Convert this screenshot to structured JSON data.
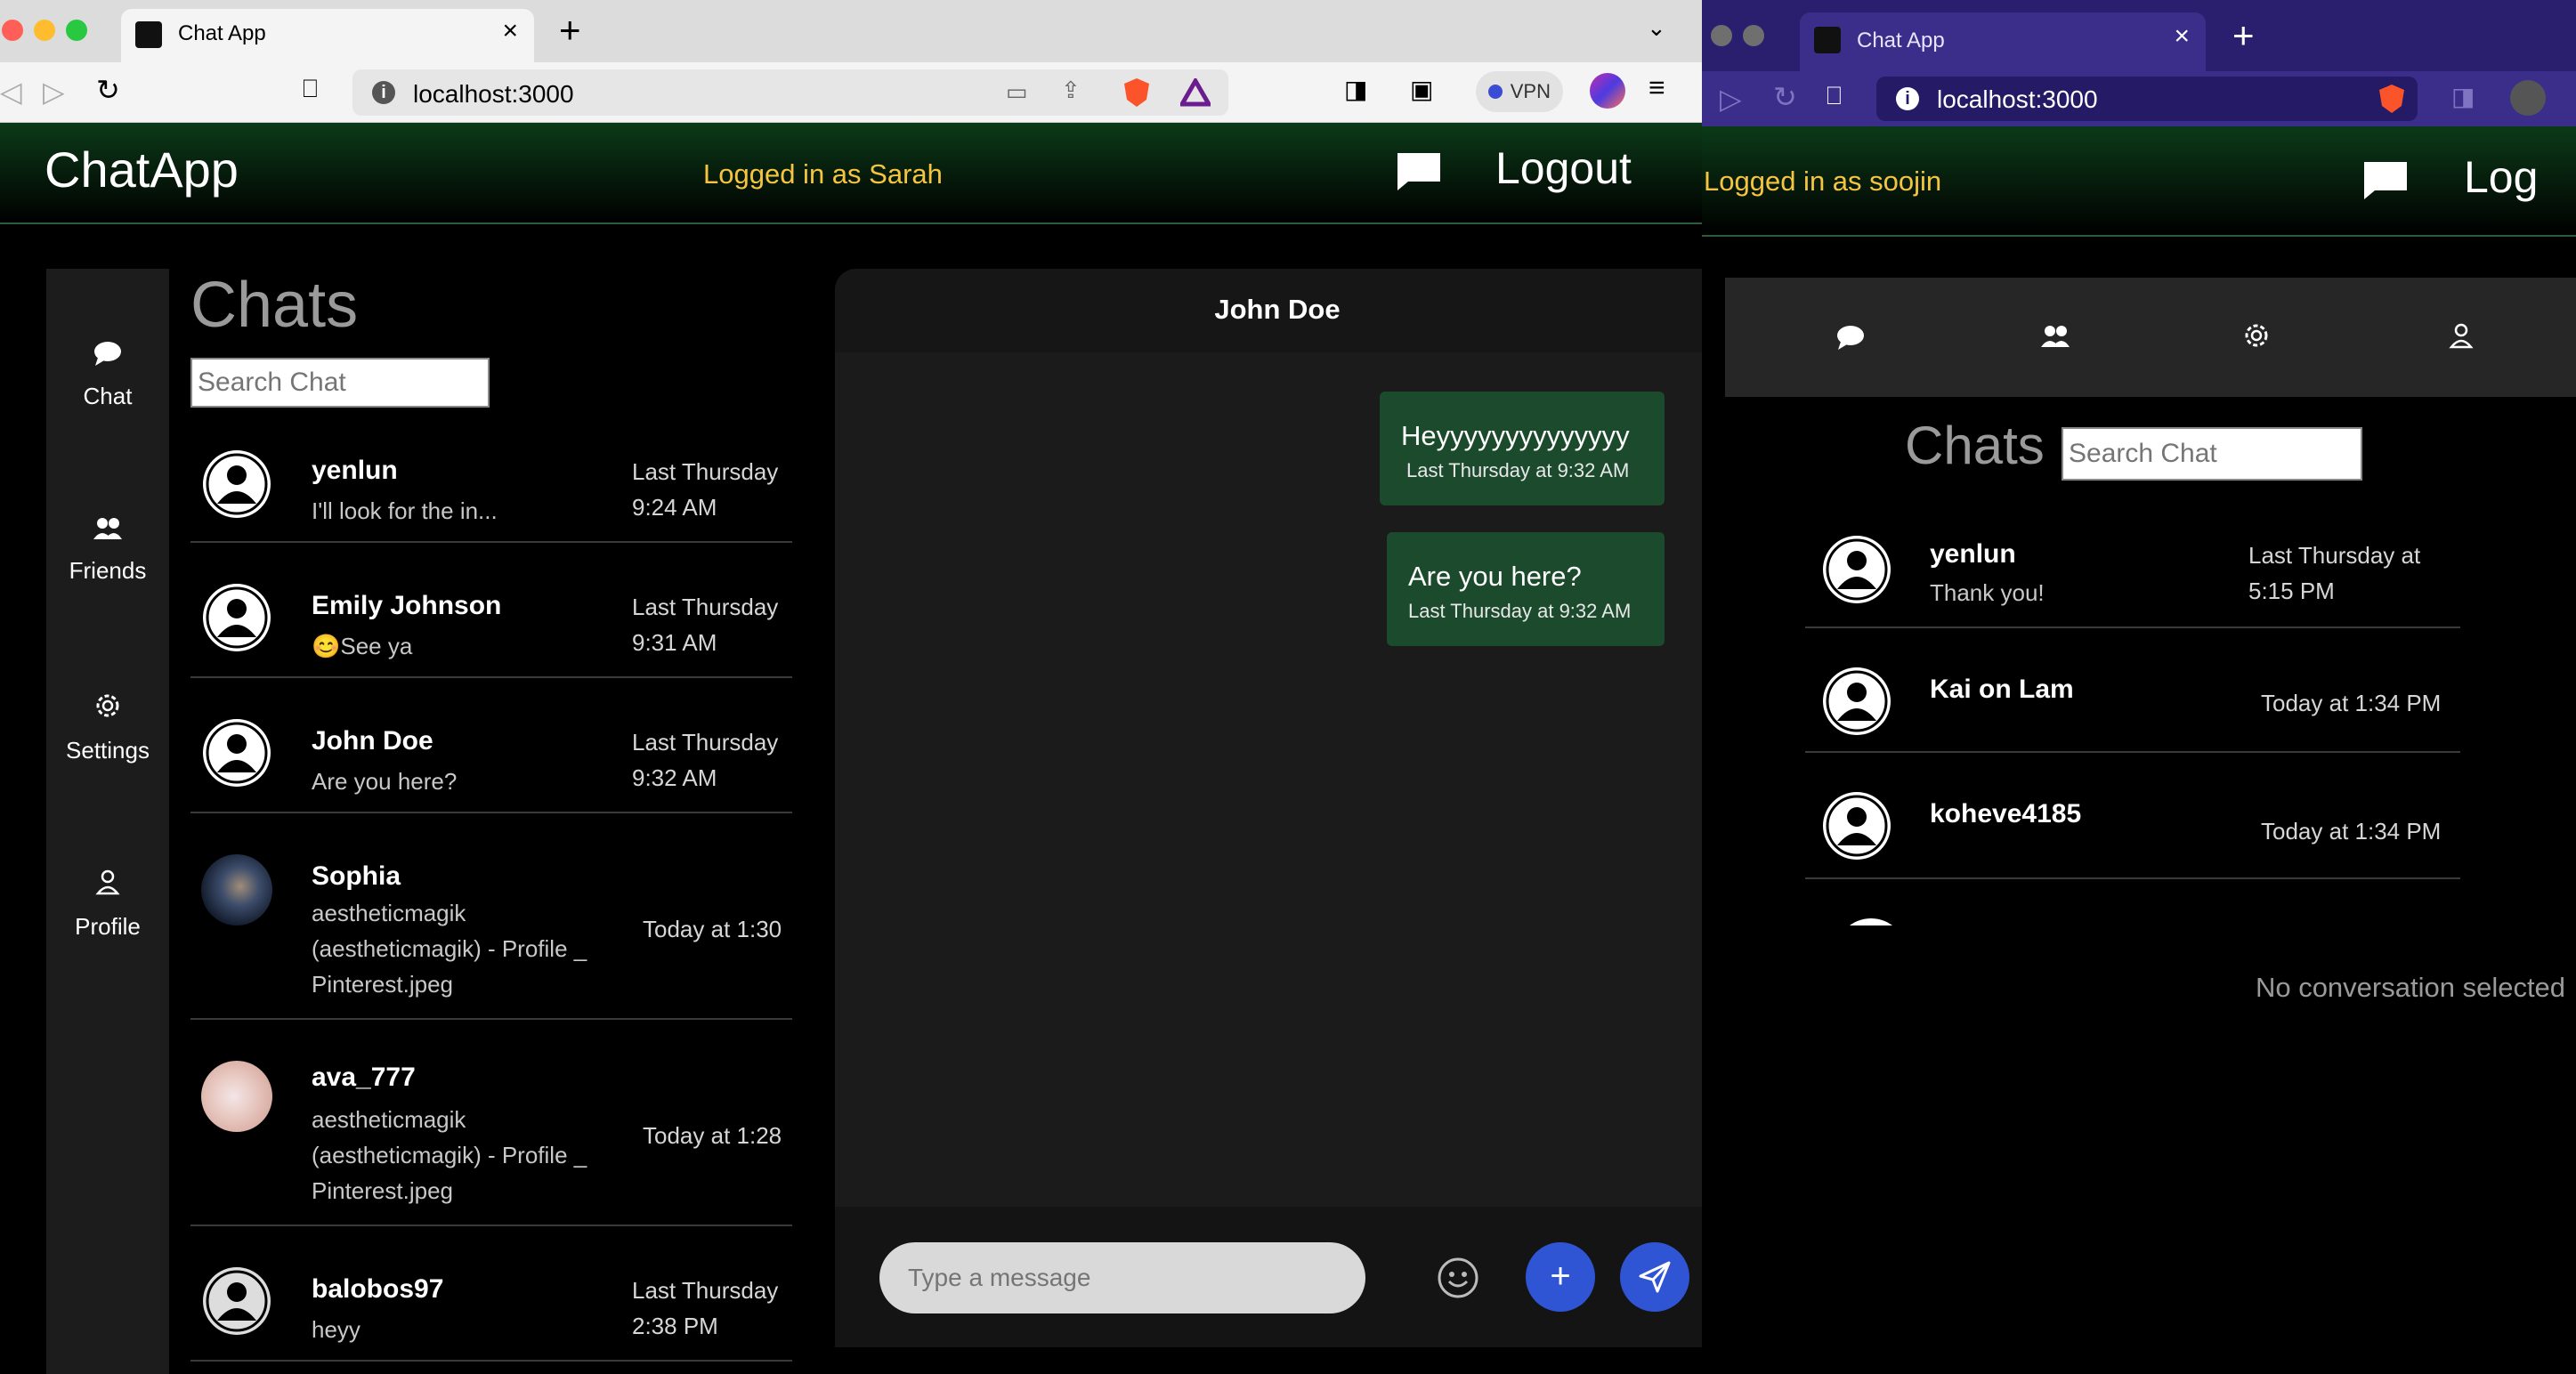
{
  "left_window": {
    "tab_title": "Chat App",
    "url": "localhost:3000",
    "vpn_label": "VPN",
    "app": {
      "brand": "ChatApp",
      "logged_in": "Logged in as Sarah",
      "logout": "Logout"
    },
    "sidenav": [
      {
        "label": "Chat",
        "icon": "chat-icon"
      },
      {
        "label": "Friends",
        "icon": "friends-icon"
      },
      {
        "label": "Settings",
        "icon": "gear-icon"
      },
      {
        "label": "Profile",
        "icon": "profile-icon"
      }
    ],
    "chats_title": "Chats",
    "search_placeholder": "Search Chat",
    "chat_list": [
      {
        "name": "yenlun",
        "message": "I'll look for the in...",
        "time_1": "Last Thursday",
        "time_2": "9:24 AM"
      },
      {
        "name": "Emily Johnson",
        "message": "😊See ya",
        "time_1": "Last Thursday",
        "time_2": "9:31 AM"
      },
      {
        "name": "John Doe",
        "message": "Are you here?",
        "time_1": "Last Thursday",
        "time_2": "9:32 AM"
      },
      {
        "name": "Sophia",
        "message_1": "aestheticmagik",
        "message_2": "(aestheticmagik) - Profile _",
        "message_3": "Pinterest.jpeg",
        "time": "Today at 1:30"
      },
      {
        "name": "ava_777",
        "message_1": "aestheticmagik",
        "message_2": "(aestheticmagik) - Profile _",
        "message_3": "Pinterest.jpeg",
        "time": "Today at 1:28"
      },
      {
        "name": "balobos97",
        "message": "heyy",
        "time_1": "Last Thursday",
        "time_2": "2:38 PM"
      }
    ],
    "conversation": {
      "contact": "John Doe",
      "messages": [
        {
          "text": "Heyyyyyyyyyyyyyy",
          "time": "Last Thursday at 9:32 AM"
        },
        {
          "text": "Are you here?",
          "time": "Last Thursday at 9:32 AM"
        }
      ],
      "input_placeholder": "Type a message"
    }
  },
  "right_window": {
    "tab_title": "Chat App",
    "url": "localhost:3000",
    "app": {
      "logged_in": "Logged in as soojin",
      "logout_partial": "Log"
    },
    "chats_title": "Chats",
    "search_placeholder": "Search Chat",
    "chat_list": [
      {
        "name": "yenlun",
        "message": "Thank you!",
        "time_1": "Last Thursday at",
        "time_2": "5:15 PM"
      },
      {
        "name": "Kai on Lam",
        "time": "Today at 1:34 PM"
      },
      {
        "name": "koheve4185",
        "time": "Today at 1:34 PM"
      }
    ],
    "empty_state": "No conversation selected"
  },
  "colors": {
    "accent_yellow": "#f5c542",
    "bubble_green": "#1b4a2c",
    "button_blue": "#2f55d4"
  }
}
